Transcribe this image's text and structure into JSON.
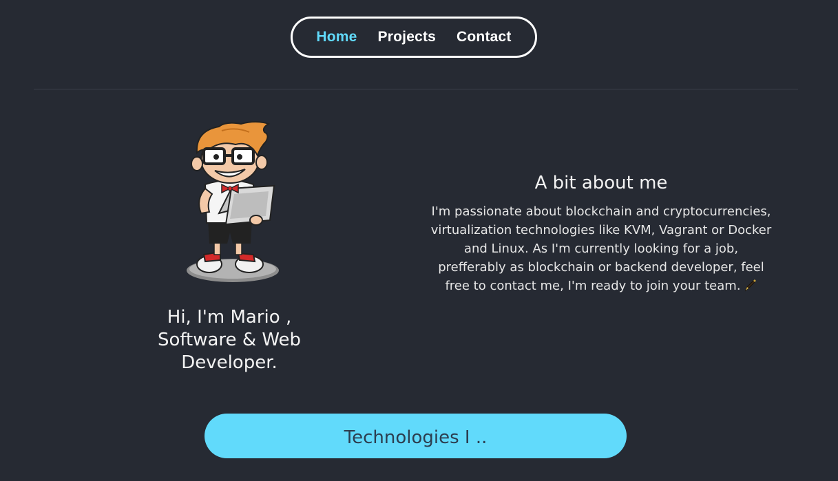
{
  "nav": {
    "items": [
      {
        "label": "Home",
        "active": true
      },
      {
        "label": "Projects",
        "active": false
      },
      {
        "label": "Contact",
        "active": false
      }
    ]
  },
  "profile": {
    "avatar_icon": "cartoon-developer-with-laptop",
    "greeting_line1": "Hi, I'm Mario ,",
    "greeting_line2": "Software & Web",
    "greeting_line3": "Developer."
  },
  "about": {
    "title": "A bit about me",
    "text": "I'm passionate about blockchain and cryptocurrencies, virtualization technologies like KVM, Vagrant or Docker and Linux. As I'm currently looking for a job, prefferably as blockchain or backend developer, feel free to contact me, I'm ready to join your team.",
    "emoji_icon": "fountain-pen-icon"
  },
  "cta": {
    "label": "Technologies I .."
  },
  "colors": {
    "background": "#262a33",
    "accent": "#61dafb",
    "button_text": "#2c3e50"
  }
}
